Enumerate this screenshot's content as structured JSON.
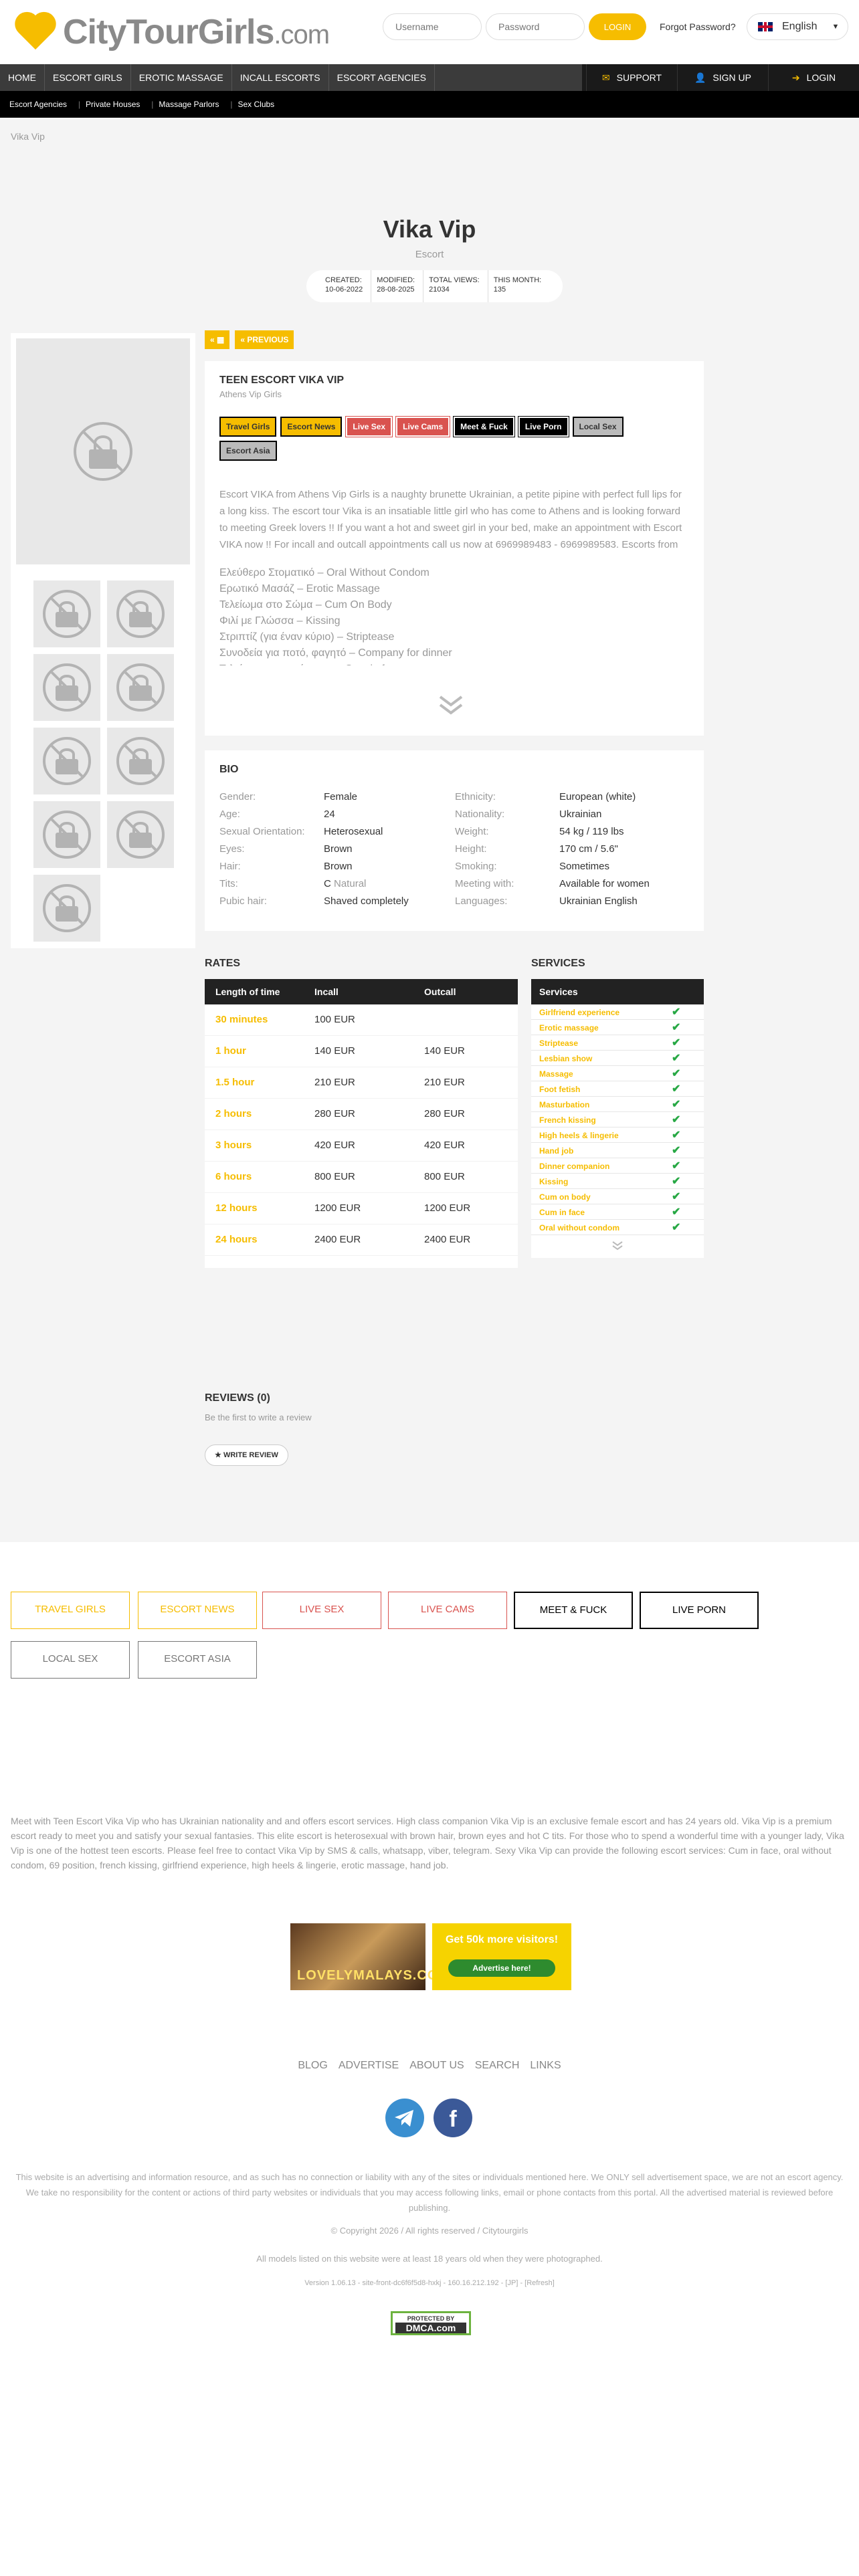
{
  "header": {
    "logo_city": "City",
    "logo_tour": "Tour",
    "logo_girls": "Girls",
    "logo_com": ".com",
    "username_placeholder": "Username",
    "password_placeholder": "Password",
    "login_button": "LOGIN",
    "forgot_password": "Forgot Password?",
    "language": "English"
  },
  "mainnav": {
    "items": [
      "HOME",
      "ESCORT GIRLS",
      "EROTIC MASSAGE",
      "INCALL ESCORTS",
      "ESCORT AGENCIES"
    ],
    "support": "SUPPORT",
    "signup": "SIGN UP",
    "login": "LOGIN"
  },
  "subnav": [
    "Escort Agencies",
    "Private Houses",
    "Massage Parlors",
    "Sex Clubs"
  ],
  "breadcrumb": "Vika Vip",
  "profile": {
    "name": "Vika Vip",
    "role": "Escort",
    "stats": [
      {
        "label": "CREATED:",
        "value": "10-06-2022"
      },
      {
        "label": "MODIFIED:",
        "value": "28-08-2025"
      },
      {
        "label": "TOTAL VIEWS:",
        "value": "21034"
      },
      {
        "label": "THIS MONTH:",
        "value": "135"
      }
    ]
  },
  "actions": {
    "grid": "«",
    "previous": "« PREVIOUS"
  },
  "description": {
    "title": "TEEN ESCORT VIKA VIP",
    "agency": "Athens Vip Girls",
    "tags": [
      {
        "label": "Travel Girls",
        "style": "y"
      },
      {
        "label": "Escort News",
        "style": "y"
      },
      {
        "label": "Live Sex",
        "style": "r"
      },
      {
        "label": "Live Cams",
        "style": "r"
      },
      {
        "label": "Meet & Fuck",
        "style": "b"
      },
      {
        "label": "Live Porn",
        "style": "b"
      },
      {
        "label": "Local Sex",
        "style": "g"
      },
      {
        "label": "Escort Asia",
        "style": "g"
      }
    ],
    "text": "Escort VIKA from Athens Vip Girls is a naughty brunette Ukrainian, a petite pipine with perfect full lips for a long kiss. The escort tour Vika is an insatiable little girl who has come to Athens and is looking forward to meeting Greek lovers !! If you want a hot and sweet girl in your bed, make an appointment with Escort VIKA now !! For incall and outcall appointments call us now at 6969989483 - 6969989583. Escorts from",
    "services_greek": [
      "Ελεύθερο Στοματικό – Oral Without Condom",
      "Ερωτικό Μασάζ – Erotic Massage",
      "Τελείωμα στο Σώμα – Cum On Body",
      "Φιλί με Γλώσσα – Kissing",
      "Στριπτίζ (για έναν κύριο) – Striptease",
      "Συνοδεία για ποτό, φαγητό – Company for dinner",
      "Τελείωμα στο πρόσωπο – Cum in face"
    ]
  },
  "bio": {
    "title": "BIO",
    "left": [
      {
        "k": "Gender:",
        "v": "Female"
      },
      {
        "k": "Age:",
        "v": "24"
      },
      {
        "k": "Sexual Orientation:",
        "v": "Heterosexual"
      },
      {
        "k": "Eyes:",
        "v": "Brown"
      },
      {
        "k": "Hair:",
        "v": "Brown"
      },
      {
        "k": "Tits:",
        "v": "C",
        "v2": "Natural"
      },
      {
        "k": "Pubic hair:",
        "v": "Shaved completely"
      }
    ],
    "right": [
      {
        "k": "Ethnicity:",
        "v": "European (white)"
      },
      {
        "k": "Nationality:",
        "v": "Ukrainian"
      },
      {
        "k": "Weight:",
        "v": "54 kg / 119 lbs"
      },
      {
        "k": "Height:",
        "v": "170 cm / 5.6\""
      },
      {
        "k": "Smoking:",
        "v": "Sometimes"
      },
      {
        "k": "Meeting with:",
        "v": "Available for women"
      },
      {
        "k": "Languages:",
        "v": "Ukrainian English"
      }
    ]
  },
  "rates": {
    "title": "RATES",
    "headers": [
      "Length of time",
      "Incall",
      "Outcall"
    ],
    "rows": [
      [
        "30 minutes",
        "100 EUR",
        ""
      ],
      [
        "1 hour",
        "140 EUR",
        "140 EUR"
      ],
      [
        "1.5 hour",
        "210 EUR",
        "210 EUR"
      ],
      [
        "2 hours",
        "280 EUR",
        "280 EUR"
      ],
      [
        "3 hours",
        "420 EUR",
        "420 EUR"
      ],
      [
        "6 hours",
        "800 EUR",
        "800 EUR"
      ],
      [
        "12 hours",
        "1200 EUR",
        "1200 EUR"
      ],
      [
        "24 hours",
        "2400 EUR",
        "2400 EUR"
      ]
    ]
  },
  "services": {
    "title": "SERVICES",
    "header": "Services",
    "items": [
      "Girlfriend experience",
      "Erotic massage",
      "Striptease",
      "Lesbian show",
      "Massage",
      "Foot fetish",
      "Masturbation",
      "French kissing",
      "High heels & lingerie",
      "Hand job",
      "Dinner companion",
      "Kissing",
      "Cum on body",
      "Cum in face",
      "Oral without condom"
    ]
  },
  "reviews": {
    "title": "REVIEWS (0)",
    "subtitle": "Be the first to write a review",
    "button": "WRITE REVIEW"
  },
  "bottom_tags": [
    {
      "label": "TRAVEL GIRLS",
      "color": "#f6bd00"
    },
    {
      "label": "ESCORT NEWS",
      "color": "#f6bd00"
    },
    {
      "label": "LIVE SEX",
      "color": "#d9534f"
    },
    {
      "label": "LIVE CAMS",
      "color": "#d9534f"
    },
    {
      "label": "MEET & FUCK",
      "color": "#000000"
    },
    {
      "label": "LIVE PORN",
      "color": "#000000"
    },
    {
      "label": "LOCAL SEX",
      "color": "#777777"
    },
    {
      "label": "ESCORT ASIA",
      "color": "#777777"
    }
  ],
  "seo_text": "Meet with Teen Escort Vika Vip who has Ukrainian nationality and and offers escort services. High class companion Vika Vip is an exclusive female escort and has 24 years old. Vika Vip is a premium escort ready to meet you and satisfy your sexual fantasies. This elite escort is heterosexual with brown hair, brown eyes and hot C tits. For those who to spend a wonderful time with a younger lady, Vika Vip is one of the hottest teen escorts. Please feel free to contact Vika Vip by SMS & calls, whatsapp, viber, telegram. Sexy Vika Vip can provide the following escort services: Cum in face, oral without condom, 69 position, french kissing, girlfriend experience, high heels & lingerie, erotic massage, hand job.",
  "ads": {
    "ad1": "LOVELYMALAYS.COM",
    "ad2_title": "Get 50k more visitors!",
    "ad2_button": "Advertise here!"
  },
  "footer": {
    "links": [
      "BLOG",
      "ADVERTISE",
      "ABOUT US",
      "SEARCH",
      "LINKS"
    ],
    "legal": "This website is an advertising and information resource, and as such has no connection or liability with any of the sites or individuals mentioned here. We ONLY sell advertisement space, we are not an escort agency. We take no responsibility for the content or actions of third party websites or individuals that you may access following links, email or phone contacts from this portal. All the advertised material is reviewed before publishing.",
    "copyright": "© Copyright 2026 / All rights reserved / Citytourgirls",
    "models": "All models listed on this website were at least 18 years old when they were photographed.",
    "version": "Version 1.06.13 - site-front-dc6f6f5d8-hxkj - 160.16.212.192 - [JP] - [Refresh]",
    "dmca_top": "PROTECTED BY",
    "dmca_bottom": "DMCA.com"
  }
}
